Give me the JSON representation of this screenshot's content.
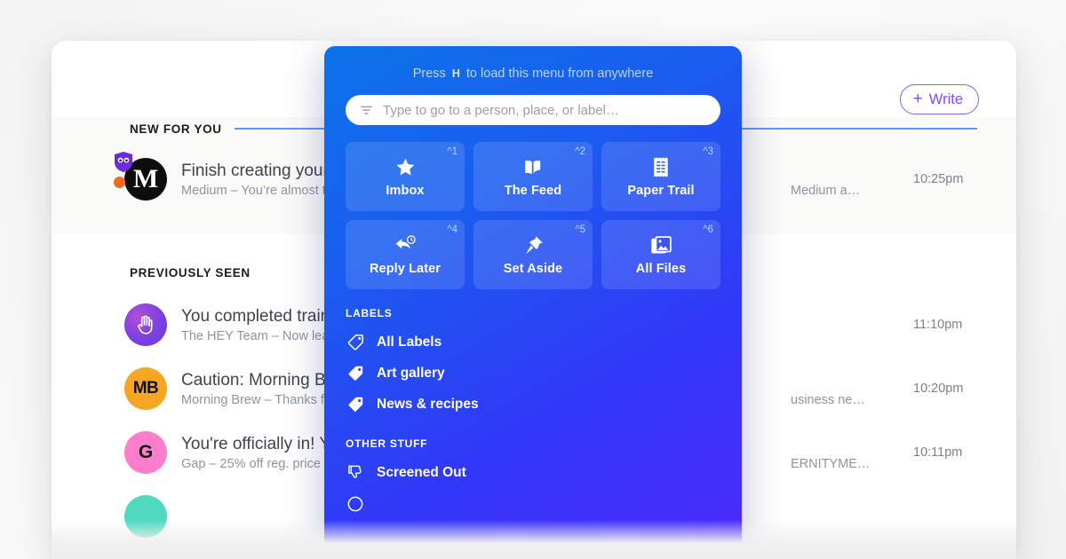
{
  "toolbar": {
    "write_label": "Write",
    "write_plus": "+"
  },
  "mail": {
    "sections": [
      {
        "title": "NEW FOR YOU"
      },
      {
        "title": "PREVIOUSLY SEEN"
      }
    ],
    "new_for_you": [
      {
        "avatar_text": "M",
        "avatar_kind": "medium",
        "subject": "Finish creating your",
        "preview": "Medium – You’re almost t",
        "preview_right": "Medium a…",
        "time": "10:25pm",
        "badge": "shield-eyes-icon",
        "dot": true
      }
    ],
    "previously_seen": [
      {
        "avatar_text": "",
        "avatar_kind": "hey",
        "subject": "You completed train",
        "preview": "The HEY Team – Now learn",
        "preview_right": "",
        "time": "11:10pm"
      },
      {
        "avatar_text": "MB",
        "avatar_kind": "mb",
        "subject": "Caution: Morning Br",
        "preview": "Morning Brew – Thanks fo",
        "preview_right": "usiness ne…",
        "time": "10:20pm"
      },
      {
        "avatar_text": "G",
        "avatar_kind": "gap",
        "subject": "You're officially in! Y",
        "preview": "Gap – 25% off reg. price s",
        "preview_right": "ERNITYME…",
        "time": "10:11pm"
      },
      {
        "avatar_text": "",
        "avatar_kind": "teal",
        "subject": "",
        "preview": "",
        "preview_right": "",
        "time": ""
      }
    ]
  },
  "overlay": {
    "hint_prefix": "Press",
    "hint_key": "H",
    "hint_suffix": "to load this menu from anywhere",
    "search_placeholder": "Type to go to a person, place, or label…",
    "search_value": "",
    "search_icon": "filter-funnel-icon",
    "tiles": [
      {
        "label": "Imbox",
        "shortcut": "^1",
        "icon": "star-icon"
      },
      {
        "label": "The Feed",
        "shortcut": "^2",
        "icon": "open-book-icon"
      },
      {
        "label": "Paper Trail",
        "shortcut": "^3",
        "icon": "receipt-icon"
      },
      {
        "label": "Reply Later",
        "shortcut": "^4",
        "icon": "reply-clock-icon"
      },
      {
        "label": "Set Aside",
        "shortcut": "^5",
        "icon": "pushpin-icon"
      },
      {
        "label": "All Files",
        "shortcut": "^6",
        "icon": "photo-stack-icon"
      }
    ],
    "groups": [
      {
        "heading": "LABELS",
        "items": [
          {
            "label": "All Labels",
            "icon": "tag-outline-icon"
          },
          {
            "label": "Art gallery",
            "icon": "tag-solid-icon"
          },
          {
            "label": "News & recipes",
            "icon": "tag-solid-icon"
          }
        ]
      },
      {
        "heading": "OTHER STUFF",
        "items": [
          {
            "label": "Screened Out",
            "icon": "thumbs-down-icon"
          }
        ]
      }
    ]
  },
  "colors": {
    "overlay_start": "#0c73e9",
    "overlay_end": "#4d2afb",
    "accent_purple": "#7c4dff",
    "rule_blue": "#4a80f0"
  }
}
